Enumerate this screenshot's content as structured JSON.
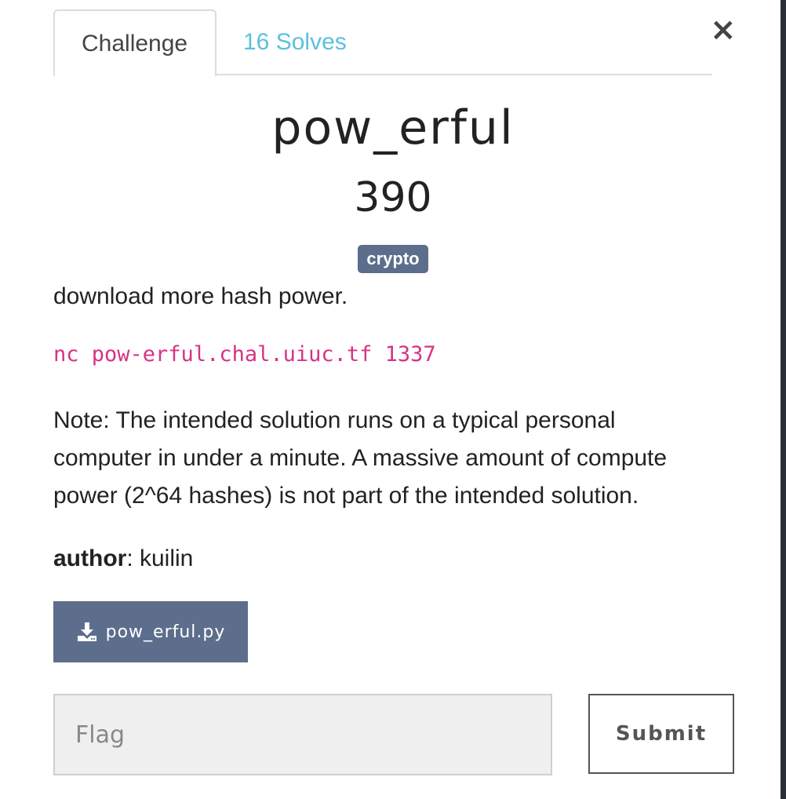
{
  "tabs": [
    {
      "label": "Challenge"
    },
    {
      "label": "16 Solves"
    }
  ],
  "challenge": {
    "name": "pow_erful",
    "points": "390",
    "category": "crypto",
    "description": "download more hash power.",
    "command": "nc pow-erful.chal.uiuc.tf 1337",
    "note": "Note: The intended solution runs on a typical personal computer in under a minute. A massive amount of compute power (2^64 hashes) is not part of the intended solution.",
    "author_label": "author",
    "author_name": ": kuilin"
  },
  "file": {
    "label": "pow_erful.py",
    "icon": "download-icon"
  },
  "form": {
    "flag_placeholder": "Flag",
    "submit_label": "Submit"
  },
  "close_icon": "close-icon",
  "colors": {
    "accent": "#5c6e8c",
    "link": "#5bc0de",
    "code": "#d63384"
  }
}
